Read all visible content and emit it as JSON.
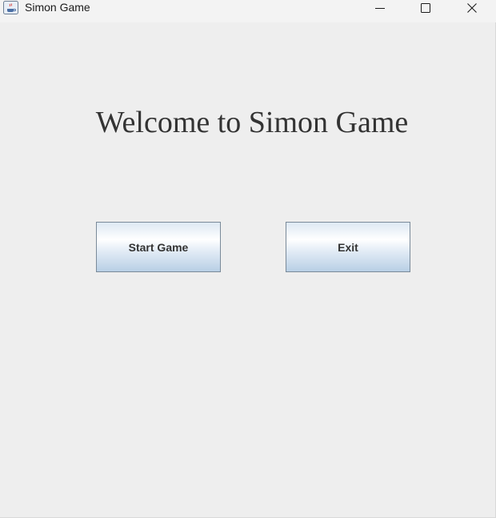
{
  "window": {
    "title": "Simon Game",
    "icon": "java-coffee-cup-icon",
    "controls": {
      "minimize": "minimize-icon",
      "maximize": "maximize-icon",
      "close": "close-icon"
    }
  },
  "main": {
    "heading": "Welcome to Simon Game",
    "start_button_label": "Start Game",
    "exit_button_label": "Exit"
  },
  "colors": {
    "background": "#eeeeee",
    "button_border": "#7a8a99",
    "text": "#333333"
  }
}
